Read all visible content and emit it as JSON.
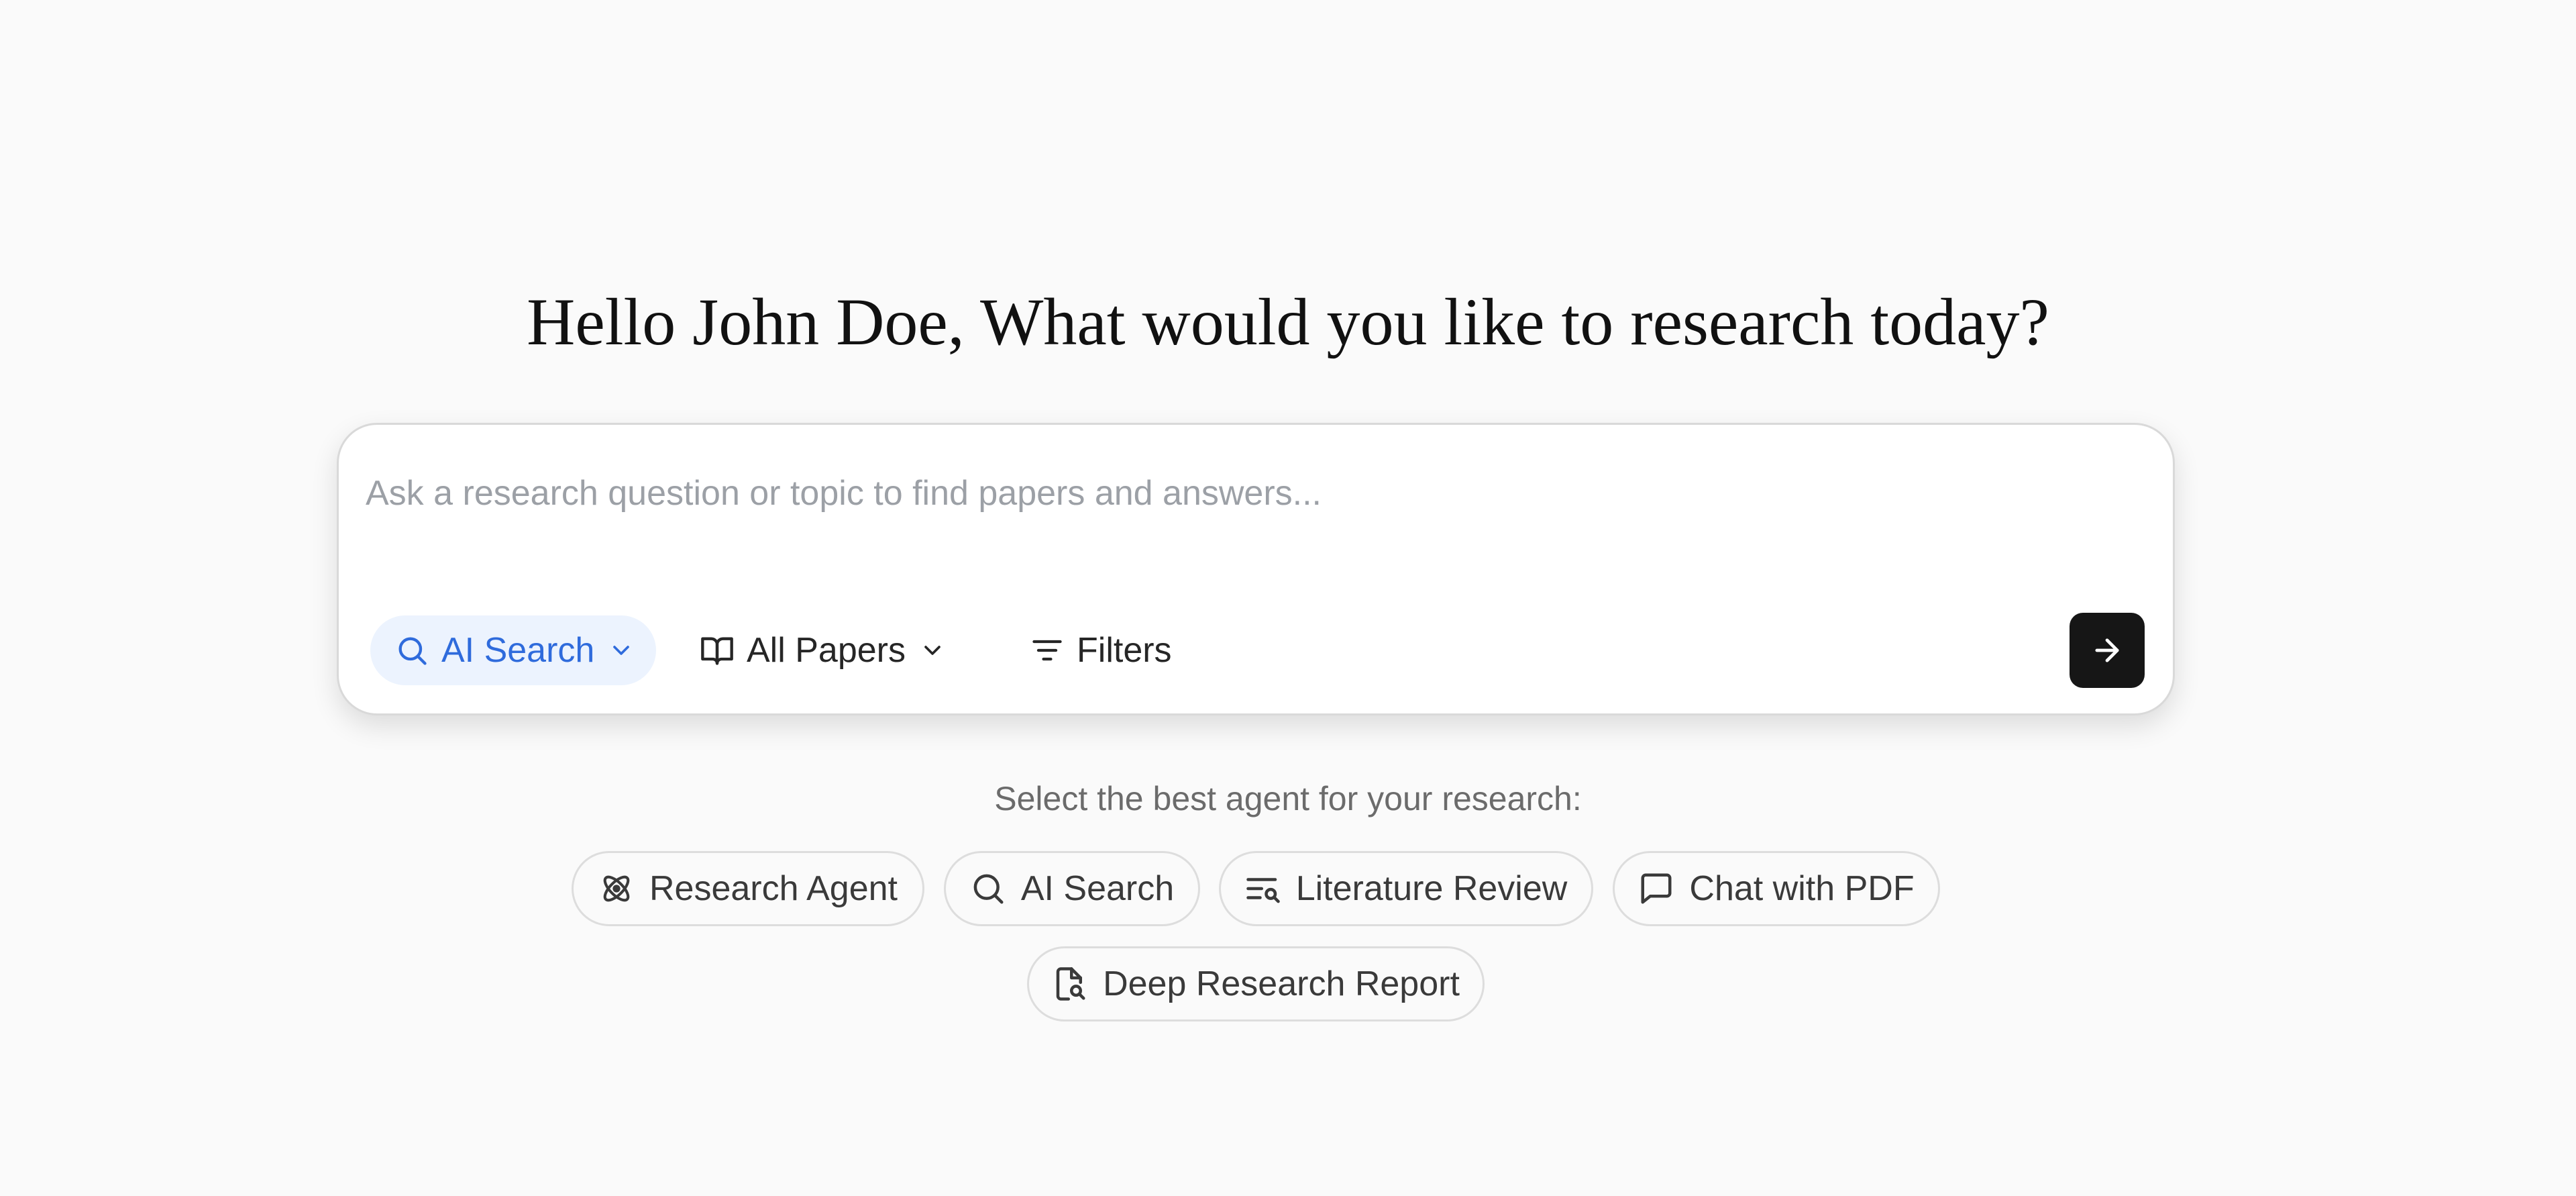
{
  "greeting": {
    "user_name": "John Doe",
    "text": "Hello John Doe, What would you like to research today?"
  },
  "search": {
    "placeholder": "Ask a research question or topic to find papers and answers...",
    "value": "",
    "mode": {
      "label": "AI Search",
      "icon": "search-icon",
      "accent_color": "#2f6bdc",
      "background": "#ecf3fe"
    },
    "source": {
      "label": "All Papers",
      "icon": "book-open-icon"
    },
    "filters": {
      "label": "Filters",
      "icon": "filter-lines-icon"
    },
    "submit": {
      "icon": "arrow-right-icon",
      "background": "#161616"
    }
  },
  "agents": {
    "caption": "Select the best agent for your research:",
    "items": [
      {
        "label": "Research Agent",
        "icon": "atom-icon"
      },
      {
        "label": "AI Search",
        "icon": "search-icon"
      },
      {
        "label": "Literature Review",
        "icon": "list-search-icon"
      },
      {
        "label": "Chat with PDF",
        "icon": "chat-bubble-icon"
      },
      {
        "label": "Deep Research Report",
        "icon": "file-search-icon"
      }
    ]
  }
}
